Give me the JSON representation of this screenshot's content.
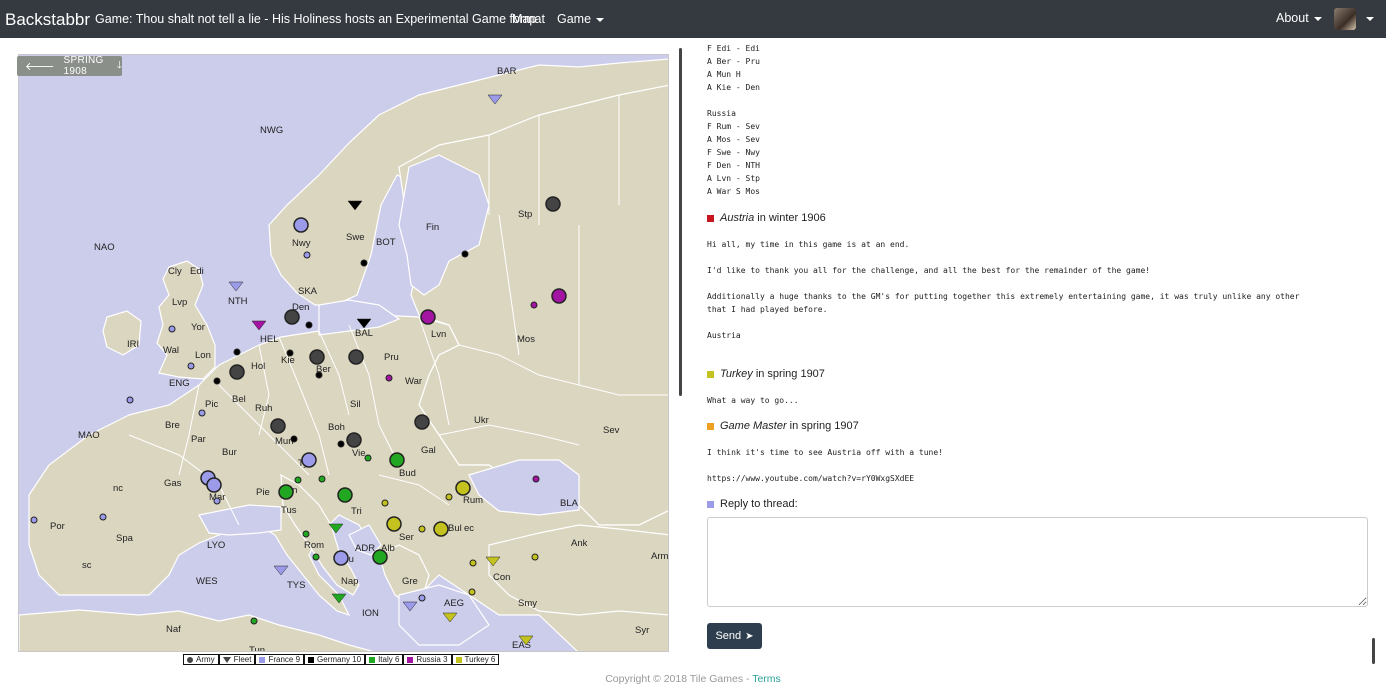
{
  "navbar": {
    "brand": "Backstabbr",
    "game_title": "Game: Thou shalt not tell a lie - His Holiness hosts an Experimental Game format",
    "map_link": "Map",
    "game_menu": "Game",
    "about_menu": "About"
  },
  "map": {
    "phase_label": "SPRING 1908",
    "labels": [
      "BAR",
      "NWG",
      "NAO",
      "Cly",
      "Edi",
      "Lvp",
      "Yor",
      "IRI",
      "Wal",
      "Lon",
      "ENG",
      "MAO",
      "Bre",
      "Pic",
      "Par",
      "Bel",
      "Hol",
      "Ruh",
      "Bur",
      "Gas",
      "Mar",
      "Pie",
      "Tus",
      "Rom",
      "Apu",
      "Nap",
      "TYS",
      "LYO",
      "WES",
      "Naf",
      "Tun",
      "Spa",
      "nc",
      "sc",
      "Por",
      "NTH",
      "HEL",
      "SKA",
      "Den",
      "Nwy",
      "Swe",
      "BOT",
      "Fin",
      "Stp",
      "BAL",
      "Kie",
      "Ber",
      "Mun",
      "Sil",
      "Pru",
      "Lvn",
      "War",
      "Mos",
      "Boh",
      "Tyr",
      "Vie",
      "Gal",
      "Ukr",
      "Sev",
      "Bud",
      "Tri",
      "Ven",
      "ADR",
      "Alb",
      "Ser",
      "Rum",
      "Bul",
      "ec",
      "BLA",
      "Con",
      "Ank",
      "Arm",
      "Smy",
      "Syr",
      "Gre",
      "AEG",
      "ION",
      "EAS"
    ],
    "colors": {
      "sea": "#cccceb",
      "land": "#dbd6c0",
      "border": "#ffffff",
      "france": "#9b9bea",
      "germany": "#000000",
      "austria": "#444444",
      "italy": "#22a722",
      "russia": "#a314a3",
      "turkey": "#c4c21f",
      "england": "#dc143c"
    }
  },
  "legend": {
    "army": "Army",
    "fleet": "Fleet",
    "powers": [
      {
        "name": "France 9",
        "color": "#9b9bea"
      },
      {
        "name": "Germany 10",
        "color": "#000000"
      },
      {
        "name": "Italy 6",
        "color": "#22a722"
      },
      {
        "name": "Russia 3",
        "color": "#a314a3"
      },
      {
        "name": "Turkey 6",
        "color": "#c4c21f"
      }
    ]
  },
  "thread": {
    "orders_lines": [
      "F Edi - Edi",
      "A Ber - Pru",
      "A Mun H",
      "A Kie - Den",
      "",
      "Russia",
      "F Rum - Sev",
      "A Mos - Sev",
      "F Swe - Nwy",
      "F Den - NTH",
      "A Lvn - Stp",
      "A War S Mos"
    ],
    "messages": [
      {
        "author": "Austria",
        "when": "in winter 1906",
        "color": "#c8141e",
        "lines": [
          "Hi all, my time in this game is at an end.",
          "",
          "I'd like to thank you all for the challenge, and all the best for the remainder of the game!",
          "",
          "Additionally a huge thanks to the GM's for putting together this extremely entertaining game, it was truly unlike any other",
          "that I had played before.",
          "",
          "Austria"
        ]
      },
      {
        "author": "Turkey",
        "when": "in spring 1907",
        "color": "#c4c21f",
        "lines": [
          "What a way to go..."
        ]
      },
      {
        "author": "Game Master",
        "when": "in spring 1907",
        "color": "#f0a020",
        "lines": [
          "I think it's time to see Austria off with a tune!",
          "",
          "https://www.youtube.com/watch?v=rY0WxgSXdEE"
        ]
      }
    ],
    "reply_label": "Reply to thread:",
    "reply_color": "#9b9bea",
    "reply_value": "",
    "send_label": "Send"
  },
  "footer": {
    "copyright": "Copyright © 2018 Tile Games - ",
    "terms": "Terms"
  }
}
